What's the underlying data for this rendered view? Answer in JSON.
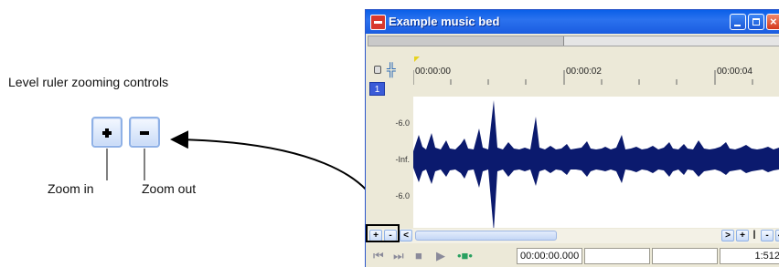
{
  "annotation": {
    "title": "Level ruler zooming controls",
    "zoom_in_label": "Zoom in",
    "zoom_out_label": "Zoom out"
  },
  "window": {
    "title": "Example music bed",
    "track_number": "1",
    "ruler_ticks": [
      "00:00:00",
      "00:00:02",
      "00:00:04"
    ],
    "level_labels": [
      "-6.0",
      "-Inf.",
      "-6.0"
    ],
    "time_display": "00:00:00.000",
    "zoom_ratio": "1:512",
    "colors": {
      "titlebar": "#0a5fe8",
      "waveform": "#0b1a6e",
      "track_badge": "#3a5bd8"
    }
  },
  "icons": {
    "big_zoom_in": "plus-icon",
    "big_zoom_out": "minus-icon",
    "mini_zoom_in": "+",
    "mini_zoom_out": "-",
    "scroll_left": "<",
    "scroll_right": ">",
    "h_zoom_in": "+",
    "h_zoom_sep": "|",
    "h_zoom_out": "-",
    "h_extra": "◆",
    "rewind": "⏮",
    "forward": "⏭",
    "stop": "■",
    "play": "▶",
    "loop": "•■•",
    "snap": "╬",
    "close": "×"
  }
}
